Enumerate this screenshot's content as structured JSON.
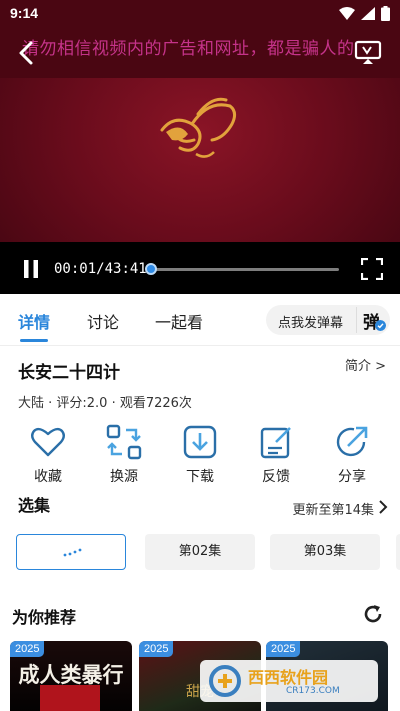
{
  "status": {
    "time": "9:14"
  },
  "player": {
    "warning_text": "请勿相信视频内的广告和网址，都是骗人的",
    "current_time": "00:01",
    "duration": "43:41",
    "progress": 0.003
  },
  "tabs": [
    {
      "label": "详情",
      "active": true
    },
    {
      "label": "讨论",
      "active": false
    },
    {
      "label": "一起看",
      "active": false
    }
  ],
  "danmaku": {
    "send_label": "点我发弹幕",
    "toggle_label": "弹"
  },
  "show": {
    "title": "长安二十四计",
    "intro_label": "简介 >",
    "meta": "大陆 · 评分:2.0 · 观看7226次"
  },
  "actions": [
    {
      "label": "收藏",
      "icon": "heart-icon"
    },
    {
      "label": "换源",
      "icon": "switch-source-icon"
    },
    {
      "label": "下载",
      "icon": "download-icon"
    },
    {
      "label": "反馈",
      "icon": "feedback-icon"
    },
    {
      "label": "分享",
      "icon": "share-icon"
    }
  ],
  "episodes": {
    "section_title": "选集",
    "updated_label": "更新至第14集",
    "items": [
      {
        "label": "",
        "playing": true
      },
      {
        "label": "第02集",
        "playing": false
      },
      {
        "label": "第03集",
        "playing": false
      }
    ]
  },
  "recommend": {
    "title": "为你推荐",
    "posters": [
      {
        "year": "2025",
        "text": "成人类暴行"
      },
      {
        "year": "2025",
        "text": "甜宠"
      },
      {
        "year": "2025",
        "text": ""
      }
    ]
  },
  "watermark": {
    "main": "西西软件园",
    "sub": "CR173.COM"
  },
  "colors": {
    "accent": "#2a86db",
    "player_bg": "#6a0c1c",
    "warning": "#c5338a"
  }
}
